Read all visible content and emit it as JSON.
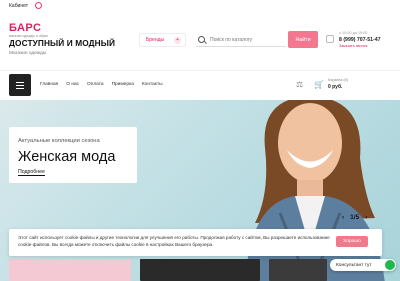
{
  "topbar": {
    "cabinet": "Кабинет"
  },
  "header": {
    "logo_brand": "БАРС",
    "logo_tagline": "магазин одежды и обуви",
    "title": "ДОСТУПНЫЙ И МОДНЫЙ",
    "subtitle": "Магазин одежды",
    "brands_label": "Бренды",
    "brands_icon": "+",
    "search_placeholder": "Поиск по каталогу",
    "search_button": "Найти",
    "hours": "с 10:00 до 19:00",
    "phone": "8 (999) 707-51-47",
    "callback": "Заказать звонок"
  },
  "nav": {
    "items": [
      "Главная",
      "О нас",
      "Оплата",
      "Примерка",
      "Контакты"
    ],
    "cart_label": "Корзина (0)",
    "cart_sum": "0 руб."
  },
  "hero": {
    "kicker": "Актуальные коллекции сезона",
    "heading": "Женская мода",
    "more": "Подробнее",
    "slide_prev": "‹",
    "slide_counter": "1/5",
    "slide_next": "›"
  },
  "cookie": {
    "text": "Этот сайт использует cookie-файлы и другие технологии для улучшения его работы. Продолжая работу с сайтом, Вы разрешаете использование cookie-файлов. Вы всегда можете отключить файлы cookie в настройках Вашего браузера.",
    "ok": "Хорошо"
  },
  "whatsapp": {
    "label": "Консультант тут"
  },
  "colors": {
    "accent": "#d8235f",
    "button": "#f3778f",
    "whatsapp": "#1fb84c"
  }
}
